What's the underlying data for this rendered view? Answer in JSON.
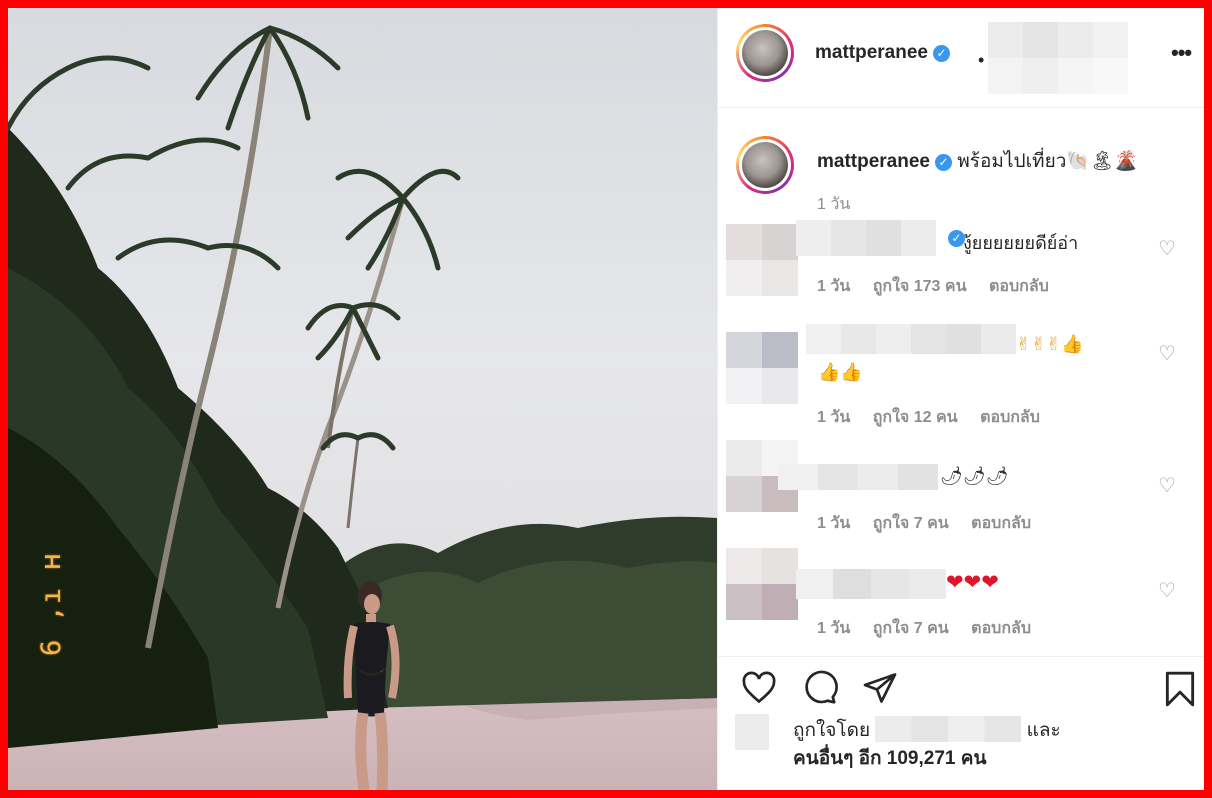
{
  "post": {
    "username": "mattperanee",
    "verified_mark": "✓",
    "dot": "•",
    "more_icon": "more-horizontal-icon",
    "caption": "พร้อมไปเที่ยว🐚🏝🌋",
    "caption_time": "1 วัน",
    "photo_datestamp": "6 ,ı ʜ"
  },
  "comments": [
    {
      "text": "งู้ยยยยยยดีย์อ่า",
      "time": "1 วัน",
      "likes": "ถูกใจ 173 คน",
      "reply": "ตอบกลับ"
    },
    {
      "text": "✌✌✌👍",
      "text2": "👍👍",
      "time": "1 วัน",
      "likes": "ถูกใจ 12 คน",
      "reply": "ตอบกลับ"
    },
    {
      "text": "🌶🌶🌶",
      "time": "1 วัน",
      "likes": "ถูกใจ 7 คน",
      "reply": "ตอบกลับ"
    },
    {
      "text": "❤❤❤",
      "time": "1 วัน",
      "likes": "ถูกใจ 7 คน",
      "reply": "ตอบกลับ"
    }
  ],
  "icons": {
    "like": "heart-outline-icon",
    "comment": "comment-bubble-icon",
    "share": "paper-plane-icon",
    "save": "bookmark-icon",
    "comment_like": "heart-small-icon"
  },
  "like_summary": {
    "prefix": "ถูกใจโดย",
    "and": "และ",
    "others": "คนอื่นๆ อีก 109,271 คน"
  },
  "colors": {
    "frame": "#ff0000",
    "verified": "#3897f0",
    "text": "#262626",
    "muted": "#8e8e8e"
  }
}
